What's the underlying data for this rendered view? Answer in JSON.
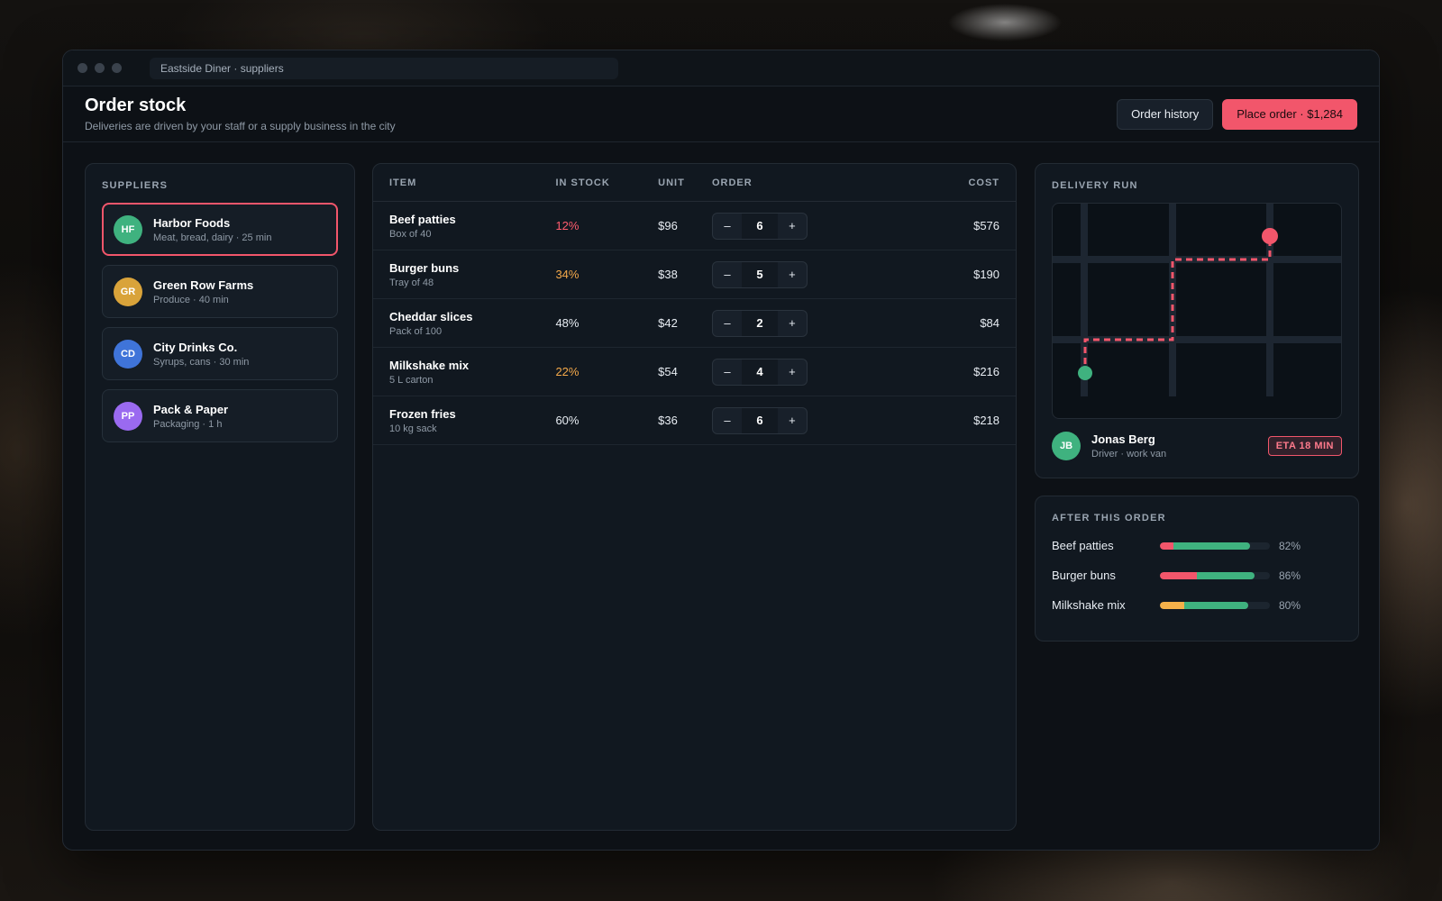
{
  "window": {
    "address": "Eastside Diner · suppliers"
  },
  "header": {
    "title": "Order stock",
    "subtitle": "Deliveries are driven by your staff or a supply business in the city",
    "history_label": "Order history",
    "place_order_label": "Place order · $1,284"
  },
  "suppliers": {
    "label": "SUPPLIERS",
    "items": [
      {
        "initials": "HF",
        "name": "Harbor Foods",
        "meta": "Meat, bread, dairy · 25 min",
        "color": "#3fb27f",
        "selected": true
      },
      {
        "initials": "GR",
        "name": "Green Row Farms",
        "meta": "Produce · 40 min",
        "color": "#d9a33a",
        "selected": false
      },
      {
        "initials": "CD",
        "name": "City Drinks Co.",
        "meta": "Syrups, cans · 30 min",
        "color": "#3f74d9",
        "selected": false
      },
      {
        "initials": "PP",
        "name": "Pack & Paper",
        "meta": "Packaging · 1 h",
        "color": "#9a6af0",
        "selected": false
      }
    ]
  },
  "table": {
    "columns": {
      "item": "ITEM",
      "stock": "IN STOCK",
      "unit": "UNIT",
      "order": "ORDER",
      "cost": "COST"
    },
    "minus": "–",
    "plus": "+",
    "rows": [
      {
        "name": "Beef patties",
        "pack": "Box of 40",
        "stock": "12%",
        "stock_color": "#ff5c6e",
        "unit": "$96",
        "qty": "6",
        "cost": "$576"
      },
      {
        "name": "Burger buns",
        "pack": "Tray of 48",
        "stock": "34%",
        "stock_color": "#f5a94a",
        "unit": "$38",
        "qty": "5",
        "cost": "$190"
      },
      {
        "name": "Cheddar slices",
        "pack": "Pack of 100",
        "stock": "48%",
        "stock_color": "#e8edf3",
        "unit": "$42",
        "qty": "2",
        "cost": "$84"
      },
      {
        "name": "Milkshake mix",
        "pack": "5 L carton",
        "stock": "22%",
        "stock_color": "#f5a94a",
        "unit": "$54",
        "qty": "4",
        "cost": "$216"
      },
      {
        "name": "Frozen fries",
        "pack": "10 kg sack",
        "stock": "60%",
        "stock_color": "#e8edf3",
        "unit": "$36",
        "qty": "6",
        "cost": "$218"
      }
    ]
  },
  "delivery": {
    "label": "DELIVERY RUN",
    "driver_initials": "JB",
    "driver_name": "Jonas Berg",
    "driver_role": "Driver · work van",
    "eta": "ETA 18 MIN"
  },
  "after": {
    "label": "AFTER THIS ORDER",
    "items": [
      {
        "name": "Beef patties",
        "current": 0.12,
        "after": 0.82,
        "pct": "82%",
        "color": "#f2566b"
      },
      {
        "name": "Burger buns",
        "current": 0.34,
        "after": 0.86,
        "pct": "86%",
        "color": "#f2566b"
      },
      {
        "name": "Milkshake mix",
        "current": 0.22,
        "after": 0.8,
        "pct": "80%",
        "color": "#f5b14a"
      }
    ]
  },
  "colors": {
    "accent": "#f2566b",
    "success": "#3fb27f"
  }
}
